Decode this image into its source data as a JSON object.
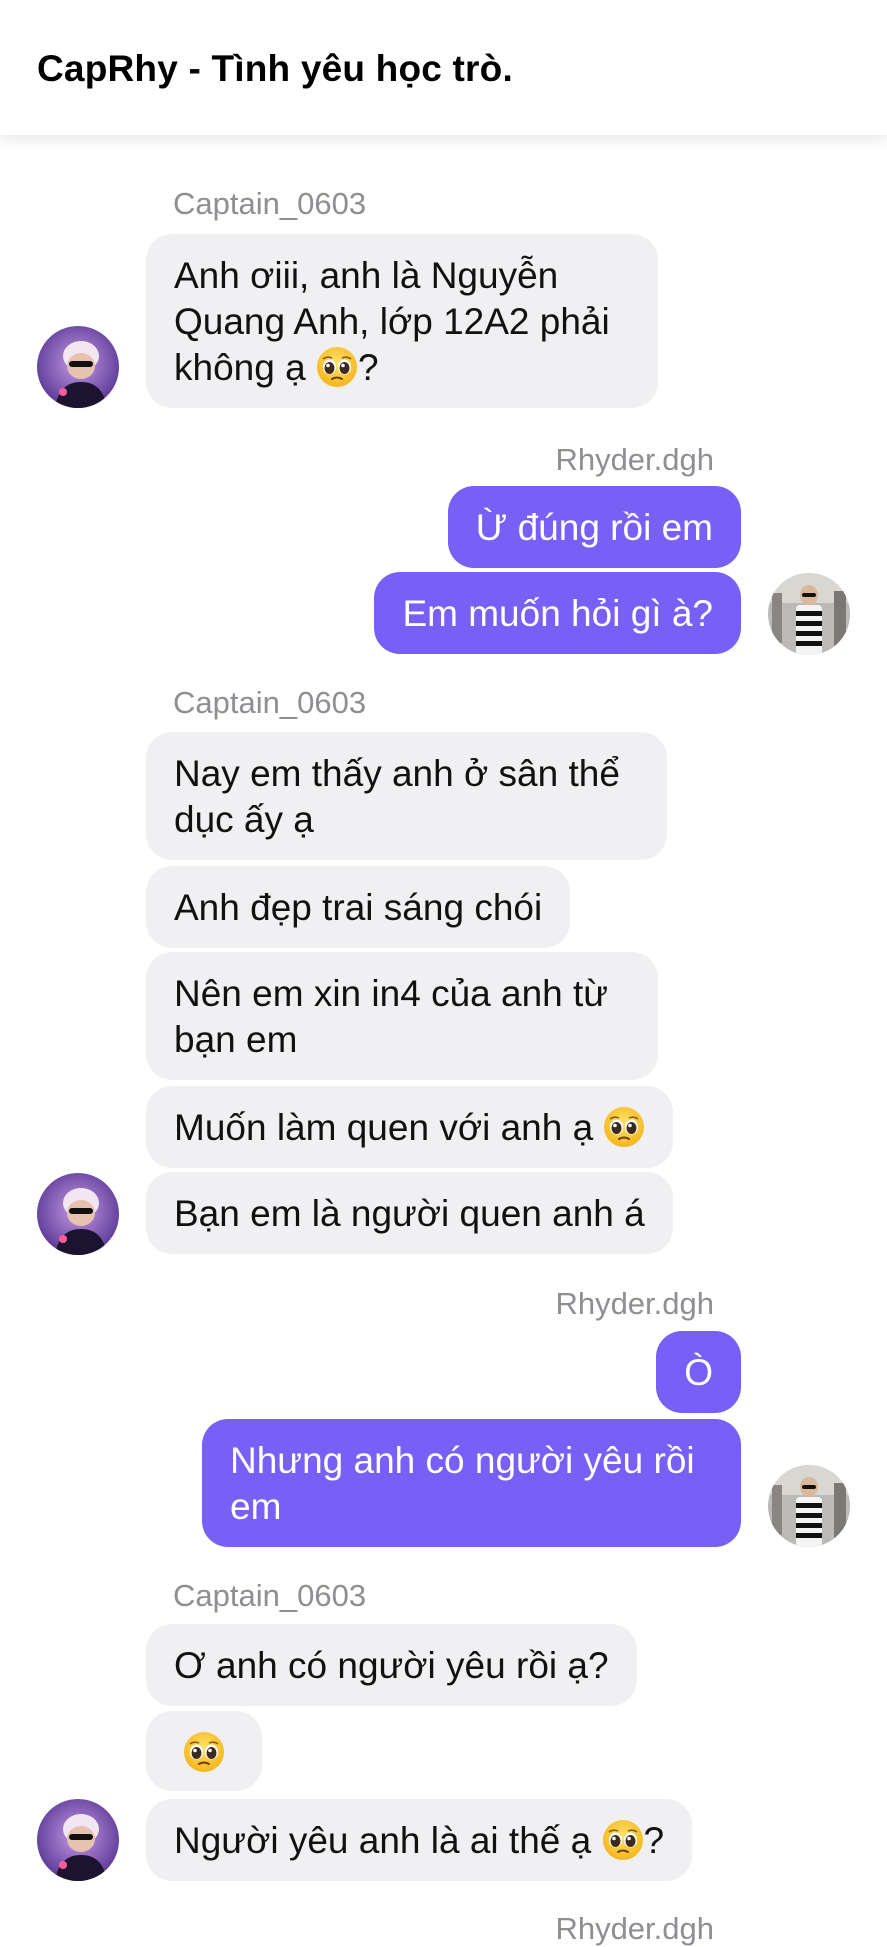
{
  "header": {
    "title": "CapRhy - Tình yêu học trò."
  },
  "users": {
    "captain": "Captain_0603",
    "rhyder": "Rhyder.dgh"
  },
  "colors": {
    "outgoing_bubble": "#7860f6",
    "incoming_bubble": "#f0f0f2",
    "sender_name": "#8e8e93"
  },
  "messages": {
    "g1": {
      "m1": {
        "text": "Anh ơiii, anh là Nguyễn Quang Anh, lớp 12A2 phải không ạ",
        "suffix": "?"
      }
    },
    "g2": {
      "m1": {
        "text": "Ừ đúng rồi em"
      },
      "m2": {
        "text": "Em muốn hỏi gì à?"
      }
    },
    "g3": {
      "m1": {
        "text": "Nay em thấy anh ở sân thể dục ấy ạ"
      },
      "m2": {
        "text": "Anh đẹp trai sáng chói"
      },
      "m3": {
        "text": "Nên em xin in4 của anh từ bạn em"
      },
      "m4": {
        "text": "Muốn làm quen với anh ạ"
      },
      "m5": {
        "text": "Bạn em là người quen anh á"
      }
    },
    "g4": {
      "m1": {
        "text": "Ò"
      },
      "m2": {
        "text": "Nhưng anh có người yêu rồi em"
      }
    },
    "g5": {
      "m1": {
        "text": "Ơ anh có người yêu rồi ạ?"
      },
      "m2": {
        "emoji": "pleading-face"
      },
      "m3": {
        "text": "Người yêu anh là ai thế ạ",
        "suffix": "?"
      }
    }
  },
  "icons": {
    "emoji": "pleading-face-emoji"
  }
}
